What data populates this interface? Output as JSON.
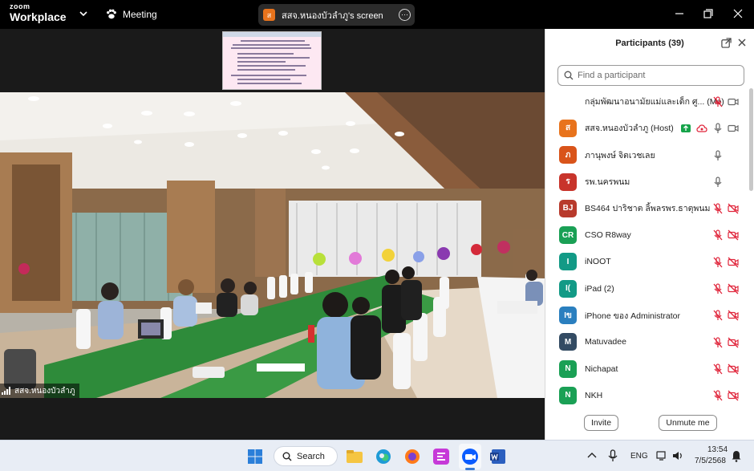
{
  "app": {
    "logo_line1": "zoom",
    "logo_line2": "Workplace",
    "meeting_label": "Meeting"
  },
  "share": {
    "avatar": "ส",
    "title": "สสจ.หนองบัวลำภู's screen"
  },
  "stage": {
    "speaker_label": "สสจ.หนองบัวลำภู"
  },
  "participants": {
    "title": "Participants (39)",
    "search_placeholder": "Find a participant",
    "items": [
      {
        "avatar": "",
        "avatar_color": "",
        "name": "กลุ่มพัฒนาอนามัยแม่และเด็ก ศู...",
        "tag": "(Me)",
        "mic": "muted",
        "video": "on"
      },
      {
        "avatar": "ส",
        "avatar_color": "#e8731c",
        "name": "สสจ.หนองบัวลำภู",
        "tag": "(Host)",
        "mic": "on",
        "video": "on",
        "share_icon": true,
        "record_icon": true
      },
      {
        "avatar": "ภ",
        "avatar_color": "#d9541a",
        "name": "ภานุพงษ์ จิตเวชเลย",
        "tag": "",
        "mic": "on",
        "video": "none"
      },
      {
        "avatar": "ร",
        "avatar_color": "#c8342b",
        "name": "รพ.นครพนม",
        "tag": "",
        "mic": "on",
        "video": "none"
      },
      {
        "avatar": "BJ",
        "avatar_color": "#b83a2c",
        "name": "BS464 ปาริชาต ลิ้พลรพร.ธาตุพนม",
        "tag": "",
        "mic": "muted",
        "video": "off"
      },
      {
        "avatar": "CR",
        "avatar_color": "#1aa055",
        "name": "CSO R8way",
        "tag": "",
        "mic": "muted",
        "video": "off"
      },
      {
        "avatar": "I",
        "avatar_color": "#129a86",
        "name": "iNOOT",
        "tag": "",
        "mic": "muted",
        "video": "off"
      },
      {
        "avatar": "I(",
        "avatar_color": "#129a86",
        "name": "iPad (2)",
        "tag": "",
        "mic": "muted",
        "video": "off"
      },
      {
        "avatar": "Iข",
        "avatar_color": "#2a7fbf",
        "name": "iPhone ของ Administrator",
        "tag": "",
        "mic": "muted",
        "video": "off"
      },
      {
        "avatar": "M",
        "avatar_color": "#334b63",
        "name": "Matuvadee",
        "tag": "",
        "mic": "muted",
        "video": "off"
      },
      {
        "avatar": "N",
        "avatar_color": "#1aa055",
        "name": "Nichapat",
        "tag": "",
        "mic": "muted",
        "video": "off"
      },
      {
        "avatar": "N",
        "avatar_color": "#1aa055",
        "name": "NKH",
        "tag": "",
        "mic": "muted",
        "video": "off"
      }
    ],
    "invite_label": "Invite",
    "unmute_label": "Unmute me"
  },
  "taskbar": {
    "search_label": "Search",
    "language": "ENG",
    "time": "13:54",
    "date": "7/5/2568"
  },
  "colors": {
    "muted_red": "#e0243a",
    "green_share": "#16a34a",
    "taskbar_bg": "#e8edf5"
  }
}
